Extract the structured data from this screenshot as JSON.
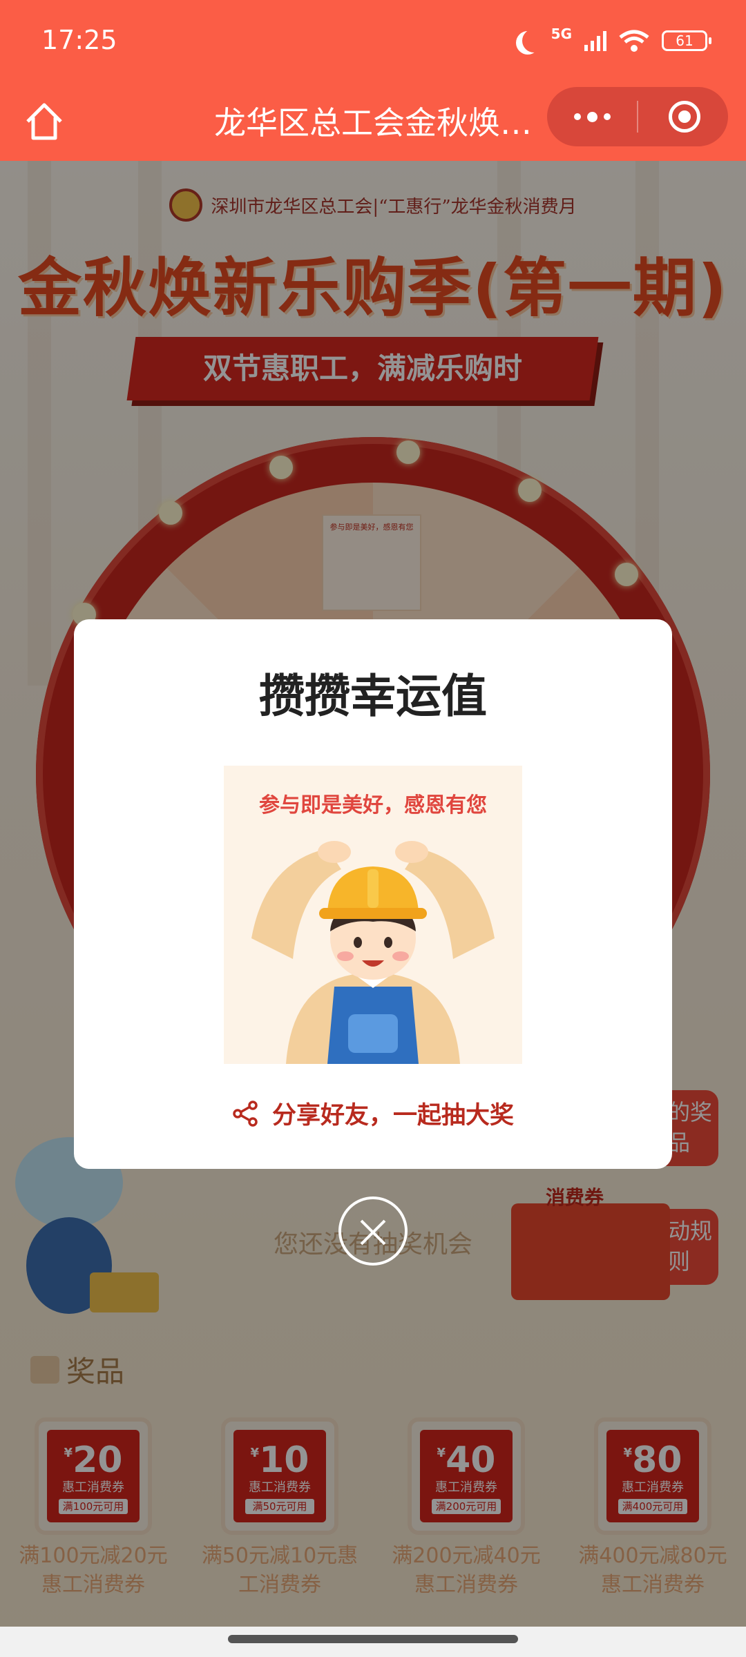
{
  "status_bar": {
    "time": "17:25",
    "network": "5G",
    "battery": "61"
  },
  "header": {
    "title": "龙华区总工会金秋焕新乐购季（第一期）"
  },
  "background": {
    "union_line": "深圳市龙华区总工会|“工惠行”龙华金秋消费月",
    "main_title": "金秋焕新乐购季(第一期)",
    "banner": "双节惠职工，满减乐购时",
    "wheel_card_caption": "参与即是美好，感恩有您",
    "my_prizes_label": "我的奖品",
    "rules_label": "活动规则",
    "coupon_tag": "消费券",
    "no_chance_text": "您还没有抽奖机会",
    "prizes_heading": "奖品",
    "prizes": [
      {
        "amount": "20",
        "type": "惠工消费券",
        "condition": "满100元可用",
        "label": "满100元减20元惠工消费券"
      },
      {
        "amount": "10",
        "type": "惠工消费券",
        "condition": "满50元可用",
        "label": "满50元减10元惠工消费券"
      },
      {
        "amount": "40",
        "type": "惠工消费券",
        "condition": "满200元可用",
        "label": "满200元减40元惠工消费券"
      },
      {
        "amount": "80",
        "type": "惠工消费券",
        "condition": "满400元可用",
        "label": "满400元减80元惠工消费券"
      }
    ]
  },
  "modal": {
    "title": "攒攒幸运值",
    "image_caption": "参与即是美好，感恩有您",
    "share_text": "分享好友，一起抽大奖"
  },
  "colors": {
    "header_red": "#fb5d46",
    "accent_red": "#b82a1e",
    "coupon_red": "#d4251c"
  }
}
